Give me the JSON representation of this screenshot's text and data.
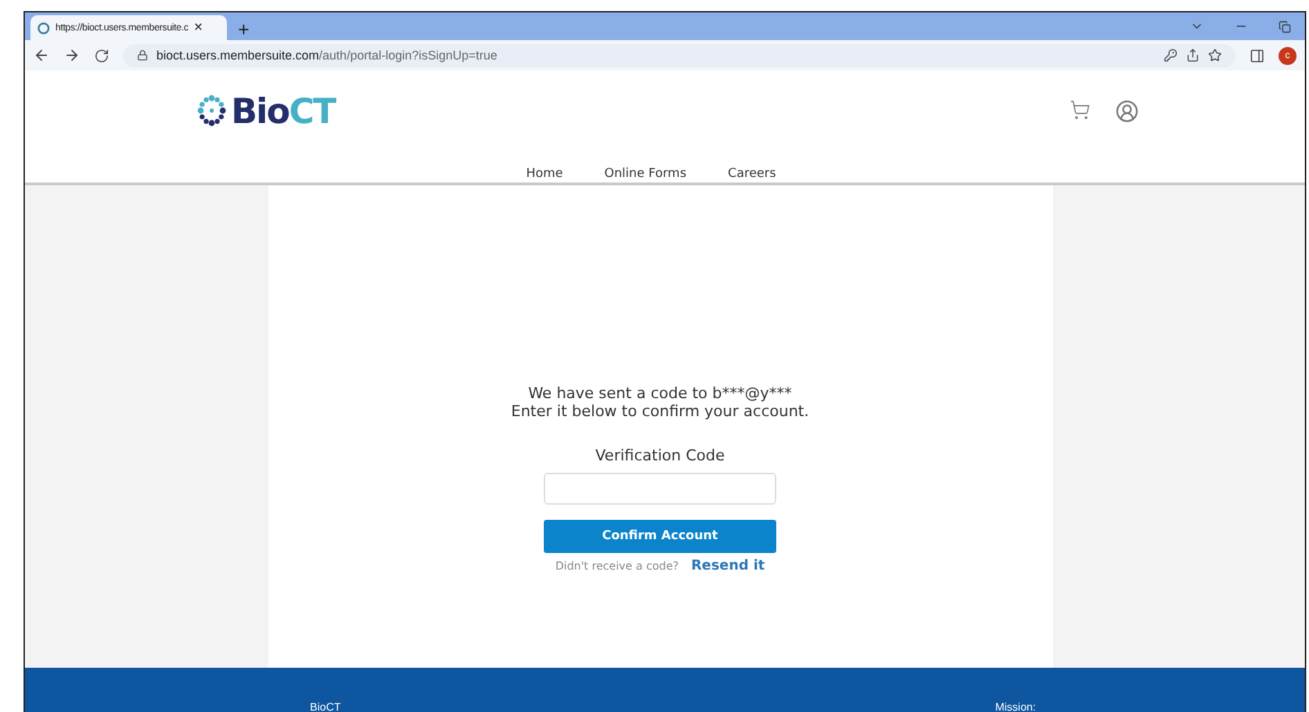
{
  "browser": {
    "tab_title": "https://bioct.users.membersuite.c",
    "tab_close": "×",
    "new_tab": "+",
    "url_host": "bioct.users.membersuite.com",
    "url_path": "/auth/portal-login?isSignUp=true",
    "profile_initial": "c"
  },
  "site": {
    "logo_dark": "Bio",
    "logo_light": "CT",
    "nav": [
      {
        "label": "Home"
      },
      {
        "label": "Online Forms"
      },
      {
        "label": "Careers"
      }
    ]
  },
  "verify": {
    "message_1": "We have sent a code to b***@y***",
    "message_2": "Enter it below to confirm your account.",
    "field_label": "Verification Code",
    "button": "Confirm Account",
    "resend_prompt": "Didn't receive a code?",
    "resend_link": "Resend it"
  },
  "footer": {
    "left": "BioCT",
    "right": "Mission:"
  }
}
